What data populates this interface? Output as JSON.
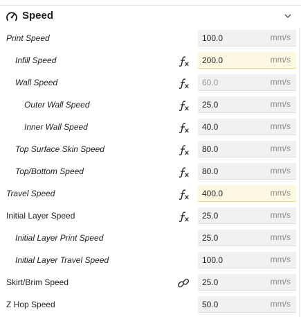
{
  "section": {
    "title": "Speed",
    "icon": "speedometer-icon",
    "collapse_icon": "chevron-down-icon"
  },
  "settings": [
    {
      "id": "print-speed",
      "label": "Print Speed",
      "italic": true,
      "indent": 0,
      "icon": "",
      "value": "100.0",
      "unit": "mm/s",
      "highlighted": false,
      "dimmed": false
    },
    {
      "id": "infill-speed",
      "label": "Infill Speed",
      "italic": true,
      "indent": 1,
      "icon": "function-icon",
      "value": "200.0",
      "unit": "mm/s",
      "highlighted": true,
      "dimmed": false
    },
    {
      "id": "wall-speed",
      "label": "Wall Speed",
      "italic": true,
      "indent": 1,
      "icon": "function-icon",
      "value": "60.0",
      "unit": "mm/s",
      "highlighted": false,
      "dimmed": true
    },
    {
      "id": "outer-wall-speed",
      "label": "Outer Wall Speed",
      "italic": true,
      "indent": 2,
      "icon": "function-icon",
      "value": "25.0",
      "unit": "mm/s",
      "highlighted": false,
      "dimmed": false
    },
    {
      "id": "inner-wall-speed",
      "label": "Inner Wall Speed",
      "italic": true,
      "indent": 2,
      "icon": "function-icon",
      "value": "40.0",
      "unit": "mm/s",
      "highlighted": false,
      "dimmed": false
    },
    {
      "id": "top-surface-skin-speed",
      "label": "Top Surface Skin Speed",
      "italic": true,
      "indent": 1,
      "icon": "function-icon",
      "value": "80.0",
      "unit": "mm/s",
      "highlighted": false,
      "dimmed": false
    },
    {
      "id": "top-bottom-speed",
      "label": "Top/Bottom Speed",
      "italic": true,
      "indent": 1,
      "icon": "function-icon",
      "value": "80.0",
      "unit": "mm/s",
      "highlighted": false,
      "dimmed": false
    },
    {
      "id": "travel-speed",
      "label": "Travel Speed",
      "italic": true,
      "indent": 0,
      "icon": "function-icon",
      "value": "400.0",
      "unit": "mm/s",
      "highlighted": true,
      "dimmed": false
    },
    {
      "id": "initial-layer-speed",
      "label": "Initial Layer Speed",
      "italic": false,
      "indent": 0,
      "icon": "function-icon",
      "value": "25.0",
      "unit": "mm/s",
      "highlighted": false,
      "dimmed": false
    },
    {
      "id": "initial-layer-print-speed",
      "label": "Initial Layer Print Speed",
      "italic": true,
      "indent": 1,
      "icon": "",
      "value": "25.0",
      "unit": "mm/s",
      "highlighted": false,
      "dimmed": false
    },
    {
      "id": "initial-layer-travel-speed",
      "label": "Initial Layer Travel Speed",
      "italic": true,
      "indent": 1,
      "icon": "",
      "value": "100.0",
      "unit": "mm/s",
      "highlighted": false,
      "dimmed": false
    },
    {
      "id": "skirt-brim-speed",
      "label": "Skirt/Brim Speed",
      "italic": false,
      "indent": 0,
      "icon": "link-icon",
      "value": "25.0",
      "unit": "mm/s",
      "highlighted": false,
      "dimmed": false
    },
    {
      "id": "z-hop-speed",
      "label": "Z Hop Speed",
      "italic": false,
      "indent": 0,
      "icon": "",
      "value": "50.0",
      "unit": "mm/s",
      "highlighted": false,
      "dimmed": false
    }
  ]
}
